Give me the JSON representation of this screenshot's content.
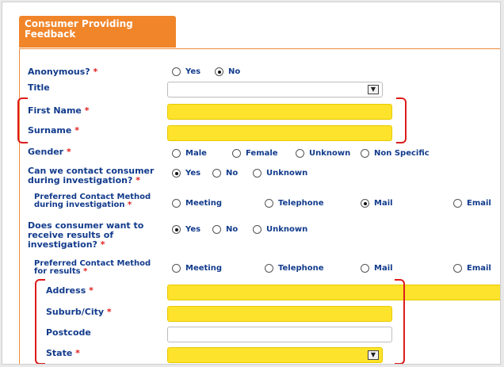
{
  "header": {
    "title": "Consumer Providing Feedback"
  },
  "required_mark": "*",
  "anonymous": {
    "label": "Anonymous?",
    "options": [
      "Yes",
      "No"
    ],
    "selected": "No"
  },
  "title_field": {
    "label": "Title",
    "value": ""
  },
  "first_name": {
    "label": "First Name",
    "value": ""
  },
  "surname": {
    "label": "Surname",
    "value": ""
  },
  "gender": {
    "label": "Gender",
    "options": [
      "Male",
      "Female",
      "Unknown",
      "Non Specific"
    ],
    "selected": null
  },
  "contact_during": {
    "label": "Can we contact consumer during investigation?",
    "options": [
      "Yes",
      "No",
      "Unknown"
    ],
    "selected": "Yes"
  },
  "pref_contact_during": {
    "label": "Preferred Contact Method during investigation",
    "options": [
      "Meeting",
      "Telephone",
      "Mail",
      "Email"
    ],
    "selected": "Mail"
  },
  "receive_results": {
    "label": "Does consumer want to receive results of investigation?",
    "options": [
      "Yes",
      "No",
      "Unknown"
    ],
    "selected": "Yes"
  },
  "pref_contact_results": {
    "label": "Preferred Contact Method for results",
    "options": [
      "Meeting",
      "Telephone",
      "Mail",
      "Email"
    ],
    "selected": null
  },
  "address": {
    "label": "Address",
    "value": ""
  },
  "suburb": {
    "label": "Suburb/City",
    "value": ""
  },
  "postcode": {
    "label": "Postcode",
    "value": ""
  },
  "state": {
    "label": "State",
    "value": ""
  },
  "colors": {
    "accent": "#f0852a",
    "label": "#123b8c",
    "required": "#e02020",
    "highlight": "#fde32b",
    "annotation": "#dd1b1b"
  }
}
